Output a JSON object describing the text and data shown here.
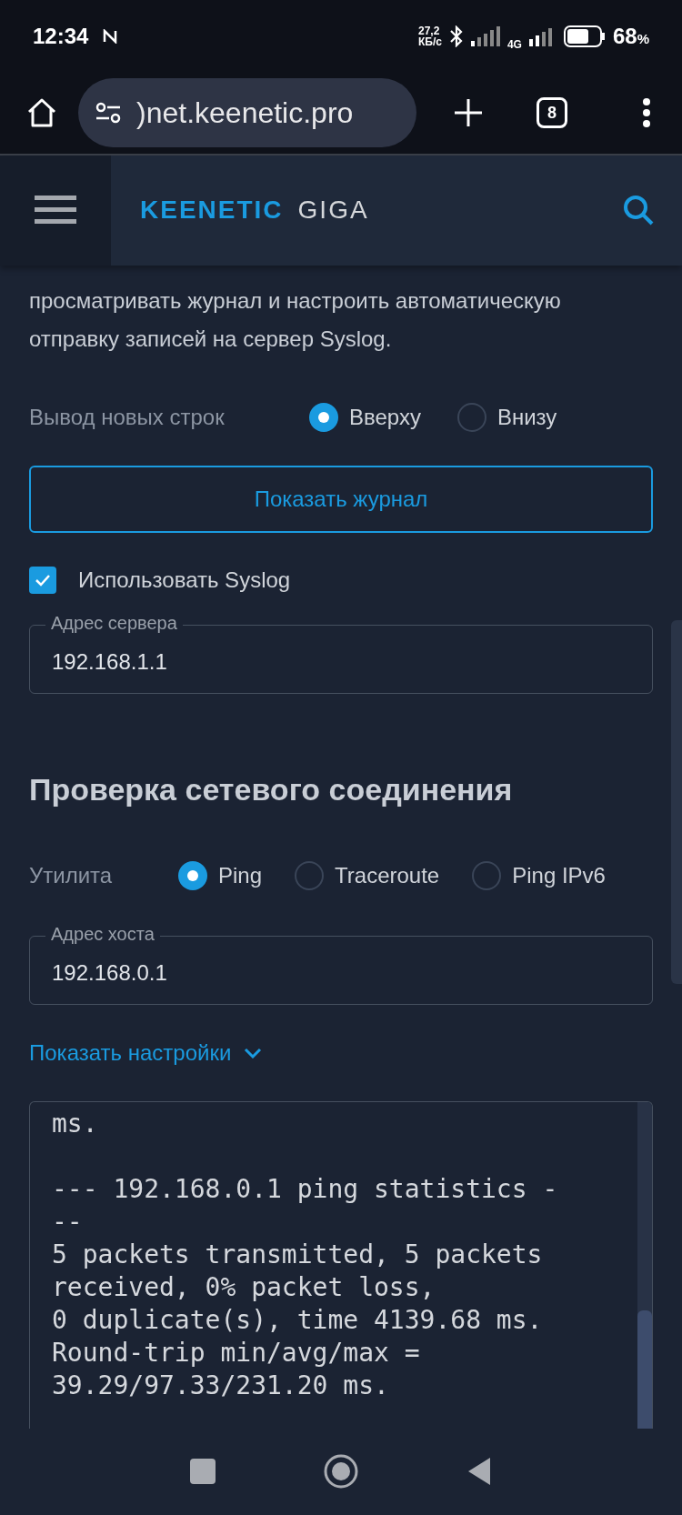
{
  "status_bar": {
    "time": "12:34",
    "speed": "27,2",
    "speed_unit": "КБ/с",
    "network": "4G",
    "battery": "68",
    "battery_unit": "%"
  },
  "browser": {
    "url": ")net.keenetic.pro",
    "tab_count": "8"
  },
  "header": {
    "brand": "KEENETIC",
    "model": "GIGA"
  },
  "intro": "просматривать журнал и настроить автоматическую отправку записей на сервер Syslog.",
  "output_order": {
    "label": "Вывод новых строк",
    "options": [
      {
        "label": "Вверху",
        "selected": true
      },
      {
        "label": "Внизу",
        "selected": false
      }
    ]
  },
  "show_log_button": "Показать журнал",
  "syslog": {
    "label": "Использовать Syslog",
    "checked": true
  },
  "server_field": {
    "label": "Адрес сервера",
    "value": "192.168.1.1"
  },
  "section_title": "Проверка сетевого соединения",
  "utility": {
    "label": "Утилита",
    "options": [
      {
        "label": "Ping",
        "selected": true
      },
      {
        "label": "Traceroute",
        "selected": false
      },
      {
        "label": "Ping IPv6",
        "selected": false
      }
    ]
  },
  "host_field": {
    "label": "Адрес хоста",
    "value": "192.168.0.1"
  },
  "settings_link": "Показать настройки",
  "log": {
    "paragraphs": [
      [
        "ms."
      ],
      [
        "--- 192.168.0.1 ping statistics -",
        "--",
        "5 packets transmitted, 5 packets",
        "received, 0% packet loss,",
        "0 duplicate(s), time 4139.68 ms.",
        "Round-trip min/avg/max =",
        "39.29/97.33/231.20 ms."
      ]
    ]
  }
}
